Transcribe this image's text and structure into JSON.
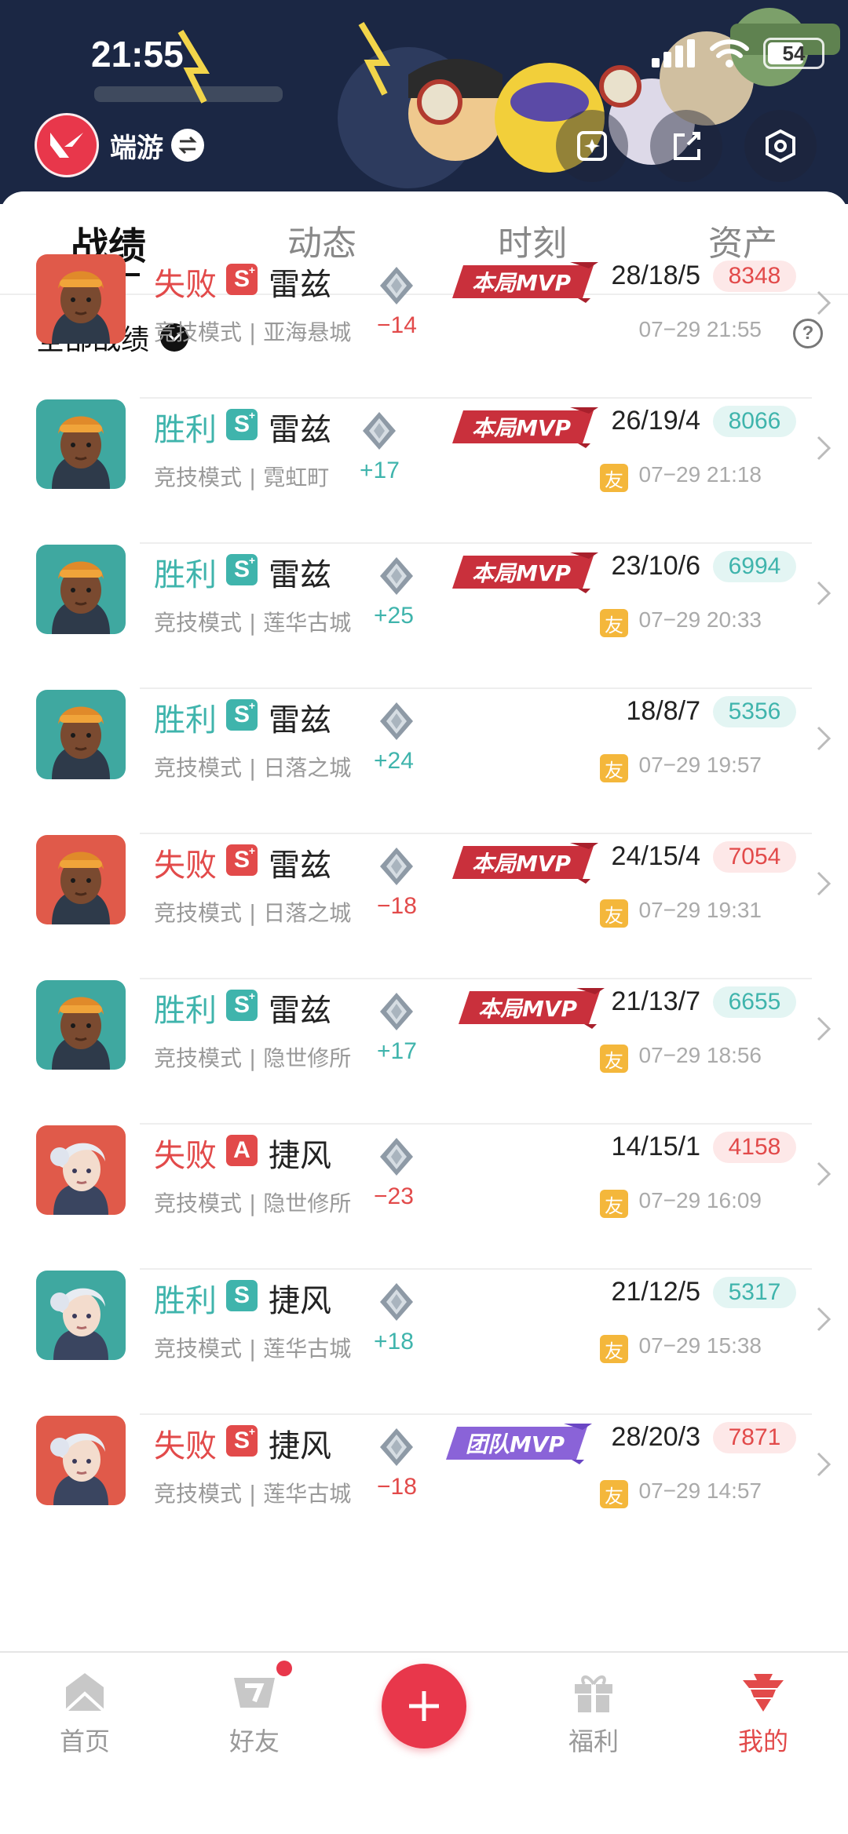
{
  "status_bar": {
    "time": "21:55",
    "battery": "54"
  },
  "header": {
    "app_name": "端游"
  },
  "tabs": [
    {
      "label": "战绩",
      "active": true
    },
    {
      "label": "动态",
      "active": false
    },
    {
      "label": "时刻",
      "active": false
    },
    {
      "label": "资产",
      "active": false
    }
  ],
  "filter": {
    "label": "全部战绩"
  },
  "mvp": {
    "match": "本局MVP",
    "team": "团队MVP"
  },
  "friend_badge": "友",
  "matches": [
    {
      "result": "失败",
      "outcome": "lose",
      "grade": "S",
      "plus": true,
      "agent": "雷兹",
      "mode": "竞技模式 | 亚海悬城",
      "delta": "−14",
      "mvp": "本局MVP",
      "kda": "28/18/5",
      "score": "8348",
      "friend": false,
      "date": "07−29 21:55"
    },
    {
      "result": "胜利",
      "outcome": "win",
      "grade": "S",
      "plus": true,
      "agent": "雷兹",
      "mode": "竞技模式 | 霓虹町",
      "delta": "+17",
      "mvp": "本局MVP",
      "kda": "26/19/4",
      "score": "8066",
      "friend": true,
      "date": "07−29 21:18"
    },
    {
      "result": "胜利",
      "outcome": "win",
      "grade": "S",
      "plus": true,
      "agent": "雷兹",
      "mode": "竞技模式 | 莲华古城",
      "delta": "+25",
      "mvp": "本局MVP",
      "kda": "23/10/6",
      "score": "6994",
      "friend": true,
      "date": "07−29 20:33"
    },
    {
      "result": "胜利",
      "outcome": "win",
      "grade": "S",
      "plus": true,
      "agent": "雷兹",
      "mode": "竞技模式 | 日落之城",
      "delta": "+24",
      "mvp": "",
      "kda": "18/8/7",
      "score": "5356",
      "friend": true,
      "date": "07−29 19:57"
    },
    {
      "result": "失败",
      "outcome": "lose",
      "grade": "S",
      "plus": true,
      "agent": "雷兹",
      "mode": "竞技模式 | 日落之城",
      "delta": "−18",
      "mvp": "本局MVP",
      "kda": "24/15/4",
      "score": "7054",
      "friend": true,
      "date": "07−29 19:31"
    },
    {
      "result": "胜利",
      "outcome": "win",
      "grade": "S",
      "plus": true,
      "agent": "雷兹",
      "mode": "竞技模式 | 隐世修所",
      "delta": "+17",
      "mvp": "本局MVP",
      "kda": "21/13/7",
      "score": "6655",
      "friend": true,
      "date": "07−29 18:56"
    },
    {
      "result": "失败",
      "outcome": "lose",
      "grade": "A",
      "plus": false,
      "agent": "捷风",
      "mode": "竞技模式 | 隐世修所",
      "delta": "−23",
      "mvp": "",
      "kda": "14/15/1",
      "score": "4158",
      "friend": true,
      "date": "07−29 16:09"
    },
    {
      "result": "胜利",
      "outcome": "win",
      "grade": "S",
      "plus": false,
      "agent": "捷风",
      "mode": "竞技模式 | 莲华古城",
      "delta": "+18",
      "mvp": "",
      "kda": "21/12/5",
      "score": "5317",
      "friend": true,
      "date": "07−29 15:38"
    },
    {
      "result": "失败",
      "outcome": "lose",
      "grade": "S",
      "plus": true,
      "agent": "捷风",
      "mode": "竞技模式 | 莲华古城",
      "delta": "−18",
      "mvp": "团队MVP",
      "kda": "28/20/3",
      "score": "7871",
      "friend": true,
      "date": "07−29 14:57"
    }
  ],
  "bottom_nav": [
    {
      "label": "首页",
      "icon": "home-icon"
    },
    {
      "label": "好友",
      "icon": "friends-icon",
      "badge": true
    },
    {
      "label": "",
      "icon": "plus-icon"
    },
    {
      "label": "福利",
      "icon": "gift-icon"
    },
    {
      "label": "我的",
      "icon": "profile-icon",
      "active": true
    }
  ],
  "colors": {
    "lose": "#e24a4a",
    "win": "#3fb4ac",
    "brand": "#e8374b",
    "friend": "#f4b73b"
  }
}
